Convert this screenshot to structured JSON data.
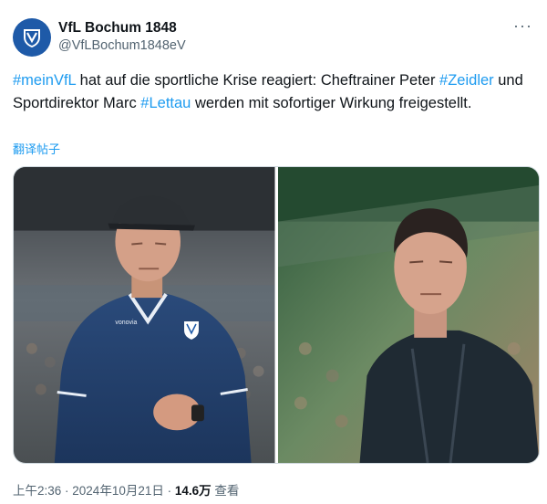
{
  "account": {
    "name": "VfL Bochum 1848",
    "handle": "@VfLBochum1848eV",
    "avatar_icon": "vfl-bochum-crest-icon",
    "more_icon": "more-options-icon",
    "more_glyph": "···"
  },
  "post": {
    "hashtag_1": "#meinVfL",
    "text_1": " hat auf die sportliche Krise reagiert: Cheftrainer Peter ",
    "hashtag_2": "#Zeidler",
    "text_2": " und Sportdirektor Marc ",
    "hashtag_3": "#Lettau",
    "text_3": " werden mit sofortiger Wirkung freigestellt.",
    "translate_label": "翻译帖子"
  },
  "media": {
    "photos": [
      "photo-head-coach",
      "photo-sporting-director"
    ],
    "shirt_sponsor": "vonovia"
  },
  "footer": {
    "time": "上午2:36",
    "separator_1": " · ",
    "date": "2024年10月21日",
    "separator_2": " · ",
    "views_count": "14.6万",
    "views_label": " 查看"
  },
  "colors": {
    "accent": "#1d9bf0",
    "text_primary": "#0f1419",
    "text_secondary": "#536471",
    "club_blue": "#1e5aa8"
  }
}
